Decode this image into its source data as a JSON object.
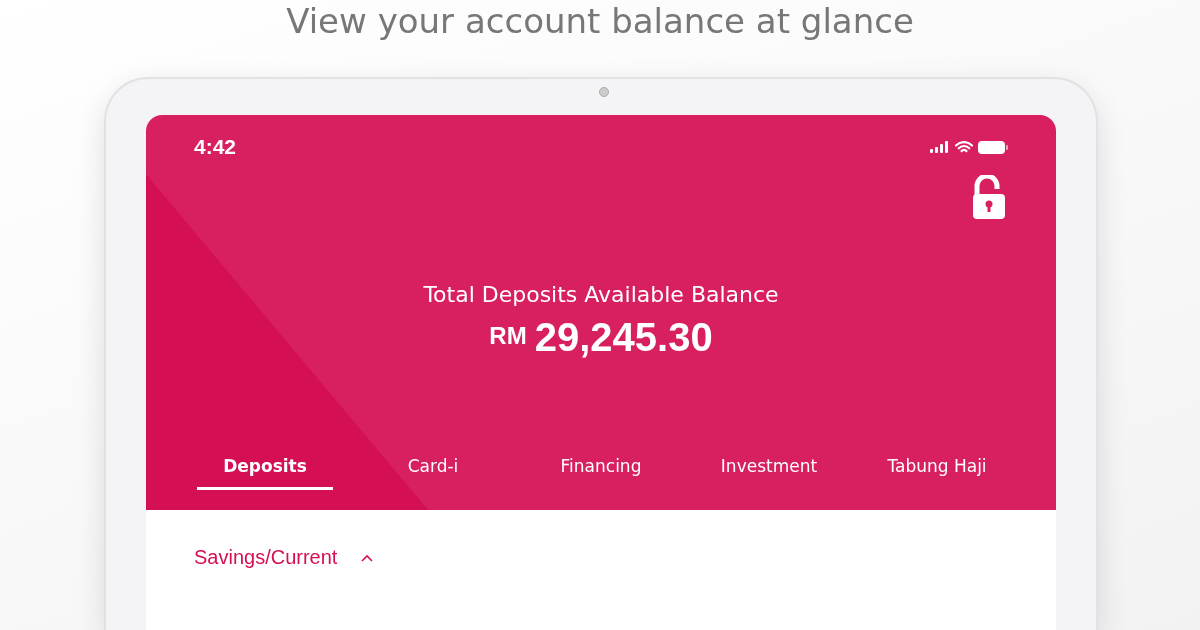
{
  "headline": "View your account balance at glance",
  "status_bar": {
    "time": "4:42"
  },
  "balance": {
    "label": "Total Deposits Available Balance",
    "currency": "RM",
    "amount": "29,245.30"
  },
  "tabs": [
    {
      "label": "Deposits",
      "selected": true
    },
    {
      "label": "Card-i",
      "selected": false
    },
    {
      "label": "Financing",
      "selected": false
    },
    {
      "label": "Investment",
      "selected": false
    },
    {
      "label": "Tabung Haji",
      "selected": false
    }
  ],
  "section": {
    "title": "Savings/Current",
    "expanded": true
  }
}
